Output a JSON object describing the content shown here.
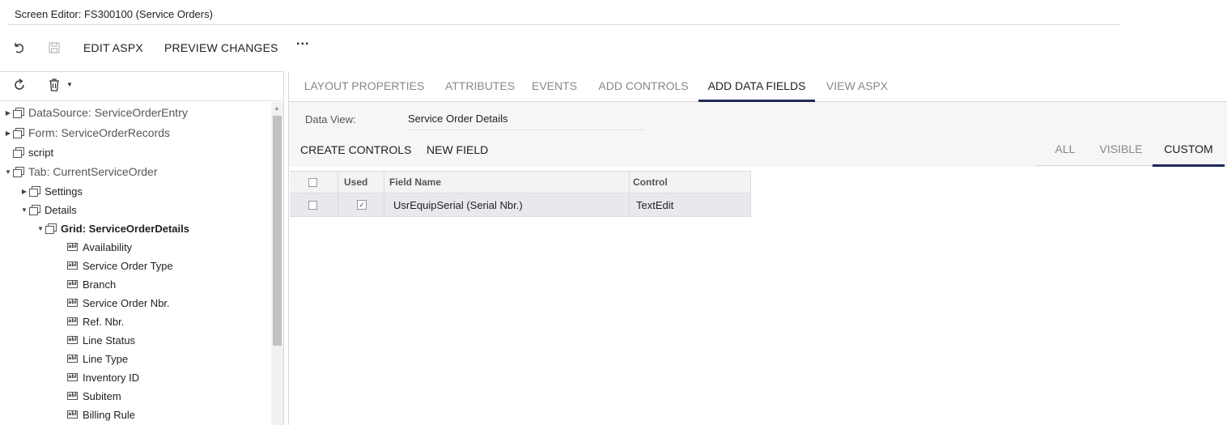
{
  "window": {
    "title": "Screen Editor: FS300100 (Service Orders)"
  },
  "toolbar": {
    "undo_icon": "undo-icon",
    "save_icon": "save-icon",
    "edit_aspx": "EDIT ASPX",
    "preview_changes": "PREVIEW CHANGES",
    "more": "···"
  },
  "left_toolbar": {
    "refresh_icon": "refresh-icon",
    "delete_icon": "trash-icon"
  },
  "tree": {
    "datasource": "DataSource: ServiceOrderEntry",
    "form": "Form: ServiceOrderRecords",
    "script": "script",
    "tab": "Tab: CurrentServiceOrder",
    "settings": "Settings",
    "details": "Details",
    "grid": "Grid: ServiceOrderDetails",
    "fields": [
      "Availability",
      "Service Order Type",
      "Branch",
      "Service Order Nbr.",
      "Ref. Nbr.",
      "Line Status",
      "Line Type",
      "Inventory ID",
      "Subitem",
      "Billing Rule"
    ]
  },
  "tabs": [
    "LAYOUT PROPERTIES",
    "ATTRIBUTES",
    "EVENTS",
    "ADD CONTROLS",
    "ADD DATA FIELDS",
    "VIEW ASPX"
  ],
  "active_tab": "ADD DATA FIELDS",
  "data_view": {
    "label": "Data View:",
    "value": "Service Order Details"
  },
  "actions": {
    "create_controls": "CREATE CONTROLS",
    "new_field": "NEW FIELD"
  },
  "filters": [
    "ALL",
    "VISIBLE",
    "CUSTOM"
  ],
  "active_filter": "CUSTOM",
  "grid": {
    "columns": [
      "Used",
      "Field Name",
      "Control"
    ],
    "rows": [
      {
        "selected": false,
        "used": true,
        "field_name": "UsrEquipSerial (Serial Nbr.)",
        "control": "TextEdit"
      }
    ]
  },
  "colors": {
    "accent": "#1e2a5a",
    "row_highlight": "#e8e8ee",
    "header_bg": "#f3f3f3"
  }
}
